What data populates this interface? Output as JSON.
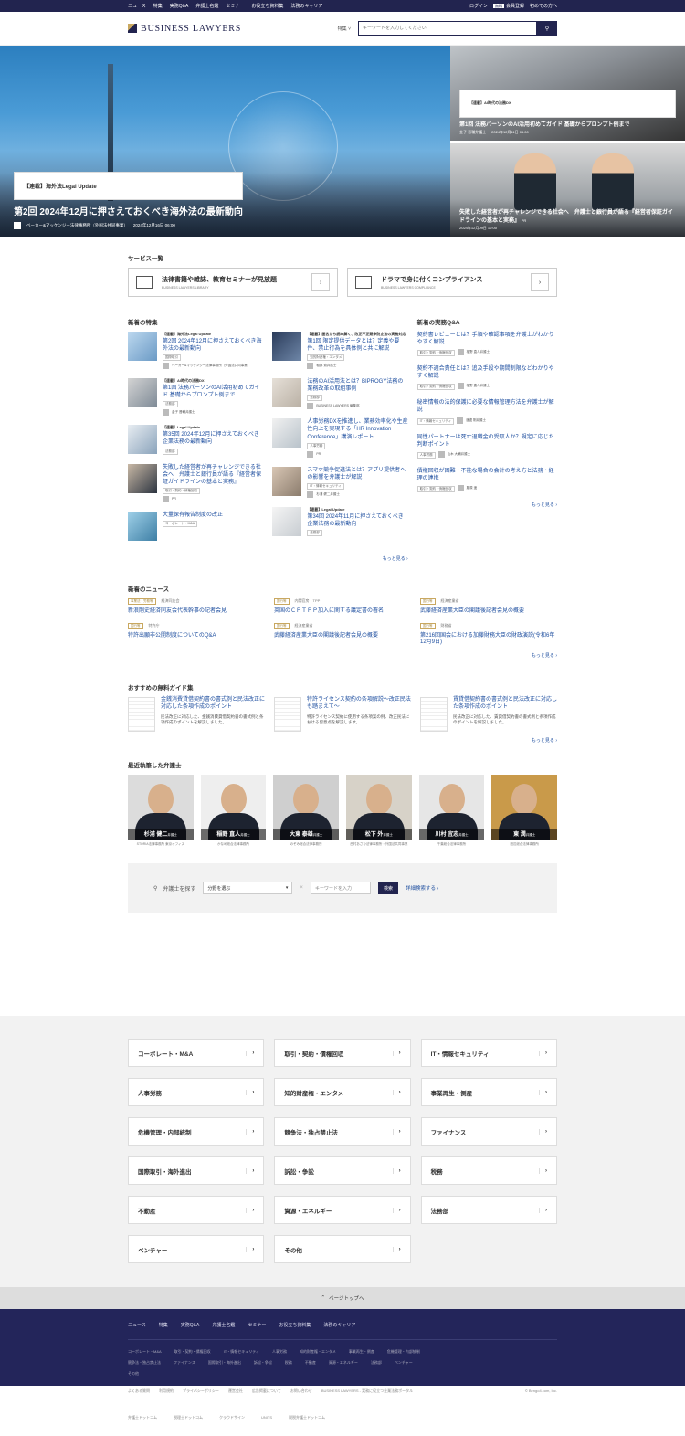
{
  "topbar": {
    "nav": [
      "ニュース",
      "特集",
      "実務Q&A",
      "弁護士名鑑",
      "セミナー",
      "お役立ち資料集",
      "法務のキャリア"
    ],
    "login": "ログイン",
    "register_badge": "無料",
    "register": "会員登録",
    "first": "初めての方へ"
  },
  "header": {
    "logo": "BUSINESS LAWYERS",
    "search_label": "特集",
    "search_placeholder": "キーワードを入力してください"
  },
  "hero": {
    "main": {
      "category": "【連載】海外法Legal Update",
      "title": "第2回 2024年12月に押さえておくべき海外法の最新動向",
      "author": "ベーカー&マッケンジー法律事務所（外国法共同事業）",
      "date": "2024年12月16日 06:00"
    },
    "side": [
      {
        "category": "【連載】AI時代の法務DX",
        "title": "第1回 法務パーソンのAI活用初めてガイド 基礎からプロンプト例まで",
        "author": "金子 晋輔弁護士",
        "date": "2024年12月11日 06:00"
      },
      {
        "category": "",
        "title": "失敗した経営者が再チャレンジできる社会へ　弁護士と銀行員が語る『経営者保証ガイドラインの基本と実務』",
        "pr": "PR",
        "date": "2024年12月09日 10:00"
      }
    ]
  },
  "services": {
    "title": "サービス一覧",
    "items": [
      {
        "title": "法律書籍や雑誌、教育セミナーが見放題",
        "sub": "BUSINESS LAWYERS LIBRARY"
      },
      {
        "title": "ドラマで身に付くコンプライアンス",
        "sub": "BUSINESS LAWYERS COMPLIANCE"
      }
    ]
  },
  "features": {
    "title": "新着の特集",
    "more": "もっと見る",
    "col1": [
      {
        "tag": "【連載】海外法Legal Update",
        "title": "第2回 2024年12月に押さえておくべき海外法の最新動向",
        "chip": "国際取引",
        "author": "ベーカー&マッケンジー法律事務所（外国法共同事業）"
      },
      {
        "tag": "【連載】AI時代の法務DX",
        "title": "第1回 法務パーソンのAI活用初めてガイド 基礎からプロンプト例まで",
        "chip": "法務部",
        "author": "金子 晋輔弁護士"
      },
      {
        "tag": "【連載】Legal Update",
        "title": "第35回 2024年12月に押さえておくべき企業法務の最新動向",
        "chip": "法務部",
        "author": ""
      },
      {
        "tag": "",
        "title": "失敗した経営者が再チャレンジできる社会へ　弁護士と銀行員が語る『経営者保証ガイドラインの基本と実務』",
        "chip": "取引・契約・債権回収",
        "author": "PR"
      },
      {
        "tag": "",
        "title": "大量保有報告制度の改正",
        "chip": "コーポレート・M&A",
        "author": ""
      }
    ],
    "col2": [
      {
        "tag": "【連載】匿名から読み解く、改正不正競争防止法の実務対応",
        "title": "第1回 限定提供データとは？定義や要件、禁止行為を具体例と共に解説",
        "chip": "知的財産権・エンタメ",
        "author": "稲部 貴弁護士"
      },
      {
        "tag": "",
        "title": "法務のAI活用法とは？BIPROGY法務の業務改革の取組事例",
        "chip": "法務部",
        "author": "BUSINESS LAWYERS 編集部"
      },
      {
        "tag": "",
        "title": "人事労務DXを推進し、業務効率化や生産性向上を実現する「HR Innovation Conference」講演レポート",
        "chip": "人事労務",
        "author": "PR"
      },
      {
        "tag": "",
        "title": "スマホ競争促進法とは？アプリ提供者への影響を弁護士が解説",
        "chip": "IT・情報セキュリティ",
        "author": "杉浦 健二弁護士"
      },
      {
        "tag": "【連載】Legal Update",
        "title": "第34回 2024年11月に押さえておくべき企業法務の最新動向",
        "chip": "法務部",
        "author": ""
      }
    ]
  },
  "qa": {
    "title": "新着の実務Q&A",
    "more": "もっと見る",
    "items": [
      {
        "title": "契約書レビューとは？手順や確認事項を弁護士がわかりやすく解説",
        "chip": "取引・契約・債権回収",
        "author": "福野 直人弁護士"
      },
      {
        "title": "契約不適合責任とは？追及手段や期間制限などわかりやすく解説",
        "chip": "取引・契約・債権回収",
        "author": "福野 直人弁護士"
      },
      {
        "title": "秘密情報の法的保護に必要な情報管理方法を弁護士が解説",
        "chip": "IT・情報セキュリティ",
        "author": "渡邊 剛弁護士"
      },
      {
        "title": "同性パートナーは死亡退職金の受取人か？規定に応じた判断ポイント",
        "chip": "人事労務",
        "author": "山木 大輔弁護士"
      },
      {
        "title": "債権回収が困難・不能な場合の会計の考え方と法務・経理の連携",
        "chip": "取引・契約・債権回収",
        "author": "藤原 遥"
      }
    ]
  },
  "news": {
    "title": "新着のニュース",
    "more": "もっと見る",
    "items": [
      {
        "badge": "事業法・労務等",
        "cat": "経済同友会",
        "title": "新浪剛史経済同友会代表幹事の記者会見"
      },
      {
        "badge": "国行等",
        "cat": "内閣官房　TPP",
        "title": "英国のＣＰＴＰＰ加入に関する議定書の署名"
      },
      {
        "badge": "国行等",
        "cat": "経済産業省",
        "title": "武藤経済産業大臣の閣議後記者会見の概要"
      },
      {
        "badge": "国行等",
        "cat": "特許庁",
        "title": "特許出願非公開制度についてのQ&A"
      },
      {
        "badge": "国行等",
        "cat": "経済産業省",
        "title": "武藤経済産業大臣の閣議後記者会見の概要"
      },
      {
        "badge": "国行等",
        "cat": "財務省",
        "title": "第216回国会における加藤財務大臣の財政演説(令和6年12月9日)"
      }
    ]
  },
  "guides": {
    "title": "おすすめの無料ガイド集",
    "more": "もっと見る",
    "items": [
      {
        "title": "金銭消費貸借契約書の書式例と民法改正に対応した条項作成のポイント",
        "desc": "民法改正に対応した、金銭消費貸借契約書の書式例と条項作成のポイントを解説しました。"
      },
      {
        "title": "特許ライセンス契約の条項解説〜改正民法も踏まえて〜",
        "desc": "特許ライセンス契約に使用する条項案の例、改正民法における留意点を解説します。"
      },
      {
        "title": "賃貸借契約書の書式例と民法改正に対応した条項作成のポイント",
        "desc": "民法改正に対応した、賃貸借契約書の書式例と条項作成のポイントを解説しました。"
      }
    ]
  },
  "lawyers": {
    "title": "最近執筆した弁護士",
    "items": [
      {
        "name": "杉浦 健二",
        "suffix": "弁護士",
        "firm": "STORIA法律事務所 東京オフィス"
      },
      {
        "name": "稲野 直人",
        "suffix": "弁護士",
        "firm": "かなめ総合法律事務所"
      },
      {
        "name": "大東 泰雄",
        "suffix": "弁護士",
        "firm": "のぞみ総合法律事務所"
      },
      {
        "name": "松下 外",
        "suffix": "弁護士",
        "firm": "西村あさひ法律事務所・外国法共同事業"
      },
      {
        "name": "川村 宜志",
        "suffix": "弁護士",
        "firm": "千葉総合法律事務所"
      },
      {
        "name": "東 潤",
        "suffix": "弁護士",
        "firm": "田辺総合法律事務所"
      }
    ]
  },
  "lawyer_search": {
    "label": "弁護士を探す",
    "select": "分野を選ぶ",
    "keyword": "キーワードを入力",
    "button": "検索",
    "advanced": "詳細検索する"
  },
  "categories": [
    "コーポレート・M&A",
    "取引・契約・債権回収",
    "IT・情報セキュリティ",
    "人事労務",
    "知的財産権・エンタメ",
    "事業再生・倒産",
    "危機管理・内部統制",
    "競争法・独占禁止法",
    "ファイナンス",
    "国際取引・海外進出",
    "訴訟・争訟",
    "税務",
    "不動産",
    "資源・エネルギー",
    "法務部",
    "ベンチャー",
    "その他"
  ],
  "pagetop": "ページトップへ",
  "footer": {
    "nav": [
      "ニュース",
      "特集",
      "実務Q&A",
      "弁護士名鑑",
      "セミナー",
      "お役立ち資料集",
      "法務のキャリア"
    ],
    "cats": [
      "コーポレート・M&A",
      "取引・契約・債権回収",
      "IT・情報セキュリティ",
      "人事労務",
      "知的財産権・エンタメ",
      "事業再生・倒産",
      "危機管理・内部統制",
      "競争法・独占禁止法",
      "ファイナンス",
      "国際取引・海外進出",
      "訴訟・争訟",
      "税務",
      "不動産",
      "資源・エネルギー",
      "法務部",
      "ベンチャー",
      "その他"
    ],
    "links": [
      "よくある質問",
      "利用規約",
      "プライバシーポリシー",
      "運営会社",
      "広告掲載について",
      "お問い合わせ",
      "BUSINESS LAWYERS - 実務に役立つ企業法務ポータル"
    ],
    "copyright": "© Bengo4.com, Inc.",
    "related": [
      "弁護士ドットコム",
      "税理士ドットコム",
      "クラウドサイン",
      "UNITS",
      "税税弁護士ドットコム"
    ]
  }
}
